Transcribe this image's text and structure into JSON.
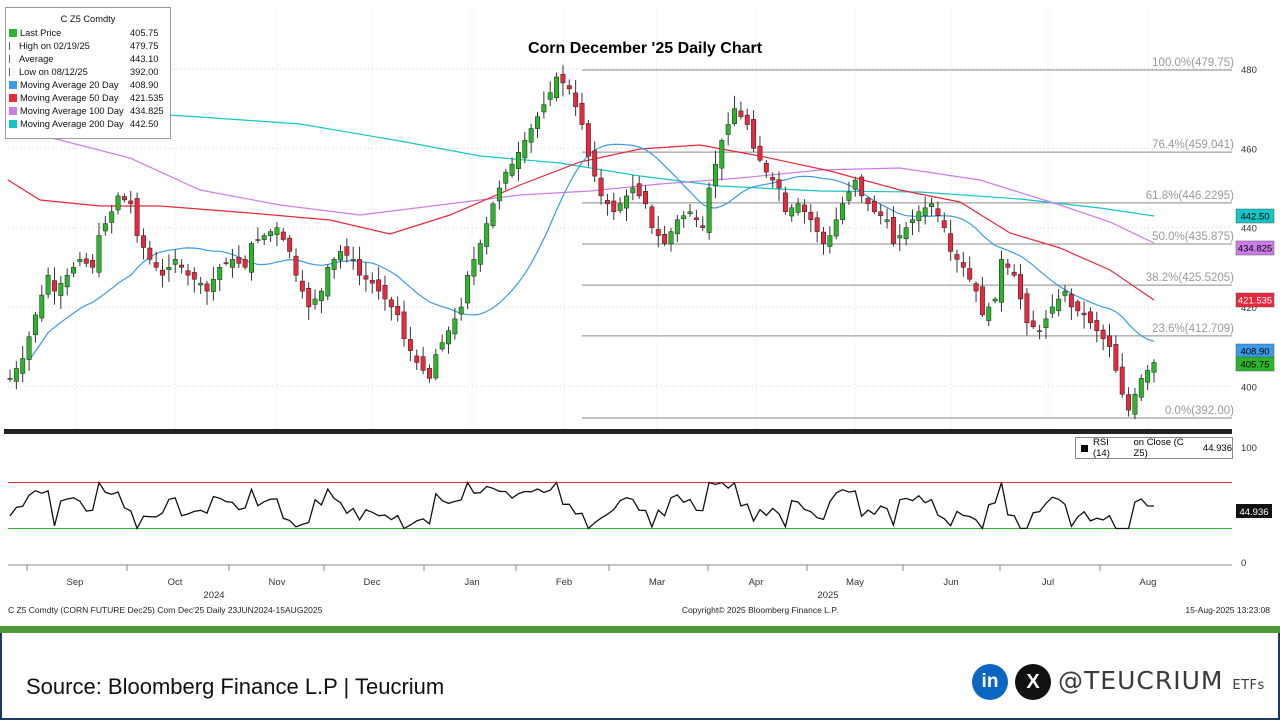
{
  "chart_data": {
    "type": "candlestick",
    "title": "Corn December '25 Daily Chart",
    "ylim": [
      385,
      485
    ],
    "y_ticks": [
      400,
      420,
      440,
      460,
      480
    ],
    "months": [
      "Sep",
      "Oct",
      "Nov",
      "Dec",
      "Jan",
      "Feb",
      "Mar",
      "Apr",
      "May",
      "Jun",
      "Jul",
      "Aug"
    ],
    "years": [
      "2024",
      "2025"
    ],
    "legend": {
      "title": "C Z5 Comdty",
      "rows": [
        {
          "label": "Last Price",
          "value": "405.75",
          "color": "#2bb52b"
        },
        {
          "label": "High on 02/19/25",
          "value": "479.75",
          "color": ""
        },
        {
          "label": "Average",
          "value": "443.10",
          "color": ""
        },
        {
          "label": "Low on 08/12/25",
          "value": "392.00",
          "color": ""
        },
        {
          "label": "Moving Average 20 Day",
          "value": "408.90",
          "color": "#3c9be8"
        },
        {
          "label": "Moving Average 50 Day",
          "value": "421.535",
          "color": "#e8283c"
        },
        {
          "label": "Moving Average 100 Day",
          "value": "434.825",
          "color": "#cc7dea"
        },
        {
          "label": "Moving Average 200 Day",
          "value": "442.50",
          "color": "#12c6c6"
        }
      ]
    },
    "fib_levels": [
      {
        "label": "100.0%(479.75)",
        "value": 479.75
      },
      {
        "label": "76.4%(459.041)",
        "value": 459.041
      },
      {
        "label": "61.8%(446.2295)",
        "value": 446.2295
      },
      {
        "label": "50.0%(435.875)",
        "value": 435.875
      },
      {
        "label": "38.2%(425.5205)",
        "value": 425.5205
      },
      {
        "label": "23.6%(412.709)",
        "value": 412.709
      },
      {
        "label": "0.0%(392.00)",
        "value": 392.0
      }
    ],
    "price_markers": [
      {
        "label": "442.50",
        "value": 442.5,
        "color": "#12c6c6",
        "text_color": "#000"
      },
      {
        "label": "434.825",
        "value": 434.825,
        "color": "#cc7dea",
        "text_color": "#000"
      },
      {
        "label": "421.535",
        "value": 421.535,
        "color": "#e8283c",
        "text_color": "#fff"
      },
      {
        "label": "408.90",
        "value": 408.9,
        "color": "#3c9be8",
        "text_color": "#000"
      },
      {
        "label": "405.75",
        "value": 405.75,
        "color": "#2bb52b",
        "text_color": "#000"
      }
    ],
    "close_path": [
      [
        0,
        402
      ],
      [
        2,
        407
      ],
      [
        4,
        418
      ],
      [
        6,
        428
      ],
      [
        7,
        424
      ],
      [
        9,
        428
      ],
      [
        11,
        432
      ],
      [
        13,
        430
      ],
      [
        14,
        438
      ],
      [
        16,
        444
      ],
      [
        17,
        448
      ],
      [
        19,
        446
      ],
      [
        20,
        438
      ],
      [
        22,
        432
      ],
      [
        24,
        428
      ],
      [
        26,
        432
      ],
      [
        28,
        428
      ],
      [
        30,
        426
      ],
      [
        31,
        424
      ],
      [
        33,
        430
      ],
      [
        35,
        432
      ],
      [
        37,
        430
      ],
      [
        38,
        436
      ],
      [
        40,
        438
      ],
      [
        42,
        440
      ],
      [
        44,
        434
      ],
      [
        45,
        428
      ],
      [
        47,
        420
      ],
      [
        49,
        424
      ],
      [
        50,
        430
      ],
      [
        52,
        434
      ],
      [
        54,
        432
      ],
      [
        55,
        428
      ],
      [
        57,
        426
      ],
      [
        59,
        422
      ],
      [
        61,
        418
      ],
      [
        62,
        412
      ],
      [
        64,
        406
      ],
      [
        66,
        402
      ],
      [
        67,
        408
      ],
      [
        69,
        414
      ],
      [
        71,
        420
      ],
      [
        72,
        428
      ],
      [
        74,
        436
      ],
      [
        76,
        446
      ],
      [
        78,
        454
      ],
      [
        79,
        456
      ],
      [
        81,
        462
      ],
      [
        83,
        468
      ],
      [
        85,
        474
      ],
      [
        86,
        478
      ],
      [
        88,
        475
      ],
      [
        90,
        466
      ],
      [
        91,
        458
      ],
      [
        93,
        448
      ],
      [
        95,
        444
      ],
      [
        97,
        448
      ],
      [
        98,
        450
      ],
      [
        100,
        446
      ],
      [
        101,
        440
      ],
      [
        103,
        436
      ],
      [
        105,
        442
      ],
      [
        107,
        444
      ],
      [
        109,
        440
      ],
      [
        110,
        450
      ],
      [
        112,
        462
      ],
      [
        114,
        470
      ],
      [
        116,
        466
      ],
      [
        117,
        460
      ],
      [
        119,
        454
      ],
      [
        121,
        450
      ],
      [
        122,
        444
      ],
      [
        124,
        446
      ],
      [
        126,
        442
      ],
      [
        128,
        436
      ],
      [
        129,
        438
      ],
      [
        131,
        446
      ],
      [
        133,
        452
      ],
      [
        134,
        448
      ],
      [
        136,
        444
      ],
      [
        138,
        442
      ],
      [
        139,
        436
      ],
      [
        141,
        440
      ],
      [
        143,
        444
      ],
      [
        145,
        446
      ],
      [
        147,
        440
      ],
      [
        148,
        434
      ],
      [
        150,
        430
      ],
      [
        152,
        424
      ],
      [
        153,
        418
      ],
      [
        155,
        422
      ],
      [
        156,
        432
      ],
      [
        158,
        428
      ],
      [
        160,
        416
      ],
      [
        162,
        414
      ],
      [
        164,
        420
      ],
      [
        166,
        424
      ],
      [
        167,
        420
      ],
      [
        169,
        418
      ],
      [
        171,
        414
      ],
      [
        173,
        410
      ],
      [
        175,
        398
      ],
      [
        176,
        394
      ],
      [
        178,
        402
      ],
      [
        180,
        406
      ]
    ],
    "rsi_value": "44.936",
    "rsi_label": "RSI (14)",
    "rsi_source": "on Close (C Z5)",
    "rsi_ticks": [
      "100",
      "0"
    ],
    "rsi_bands": [
      70,
      30
    ]
  },
  "footer": {
    "left": "C Z5 Comdty (CORN FUTURE     Dec25) Corn Dec'25  Daily 23JUN2024-15AUG2025",
    "center": "Copyright© 2025 Bloomberg Finance L.P.",
    "right": "15-Aug-2025 13:23:08"
  },
  "source_text": "Source: Bloomberg Finance L.P | Teucrium",
  "social": {
    "linkedin": "in",
    "x": "X"
  },
  "brand": {
    "name": "@TEUCRIUM",
    "suffix": "ETFs"
  }
}
